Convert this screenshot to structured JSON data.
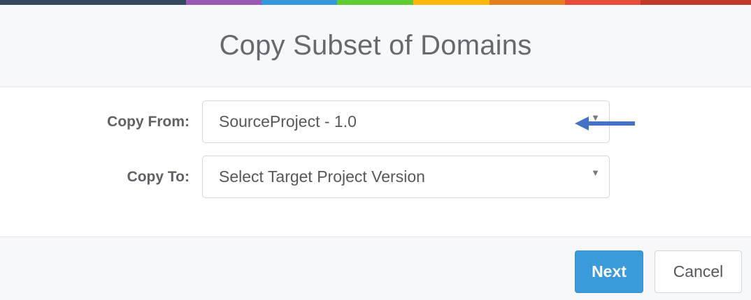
{
  "color_bar": [
    "#34495e",
    "#9b59b6",
    "#3498db",
    "#62cb31",
    "#ffb606",
    "#e67e22",
    "#e74c3c",
    "#c0392b"
  ],
  "dialog": {
    "title": "Copy Subset of Domains"
  },
  "form": {
    "copy_from": {
      "label": "Copy From:",
      "value": "SourceProject - 1.0"
    },
    "copy_to": {
      "label": "Copy To:",
      "value": "Select Target Project Version"
    },
    "annotation_arrow_color": "#4472c4"
  },
  "footer": {
    "next_label": "Next",
    "cancel_label": "Cancel"
  },
  "colors": {
    "primary": "#3b9ad9",
    "header_bg": "#f7f8fa"
  }
}
